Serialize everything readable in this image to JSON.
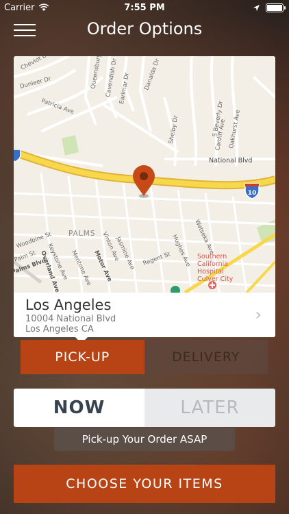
{
  "status_bar": {
    "carrier": "Carrier",
    "time": "7:55 PM"
  },
  "header": {
    "title": "Order Options"
  },
  "map": {
    "streets": [
      "Cheviot Dr",
      "Dunleer Dr",
      "Patricia Ave",
      "Queensbury Dr",
      "Cavendish Dr",
      "Earlmar Dr",
      "Danalda Dr",
      "Shelby Dr",
      "S Beverly Dr",
      "Cardiff Ave",
      "Oakhurst Ave",
      "National Blvd",
      "PALMS",
      "Woodbine St",
      "Keystone Ave",
      "Vinton Ave",
      "Jasmine Ave",
      "Regent St",
      "Hughes Ave",
      "Watseka Ave",
      "Motor Ave",
      "Mentone Ave",
      "Overland Ave",
      "Palms Blvd",
      "Palm St"
    ],
    "highway_shield": "10",
    "hospital": "Southern California Hospital Culver City"
  },
  "location": {
    "name": "Los Angeles",
    "address_line1": "10004 National Blvd",
    "address_line2": "Los Angeles CA"
  },
  "order_type": {
    "pickup": "PICK-UP",
    "delivery": "DELIVERY"
  },
  "timing": {
    "now": "NOW",
    "later": "LATER"
  },
  "timing_note": "Pick-up Your Order ASAP",
  "cta": "CHOOSE YOUR ITEMS",
  "colors": {
    "accent": "#b84416",
    "highway": "#f2cb3c",
    "pin": "#c64a18"
  }
}
